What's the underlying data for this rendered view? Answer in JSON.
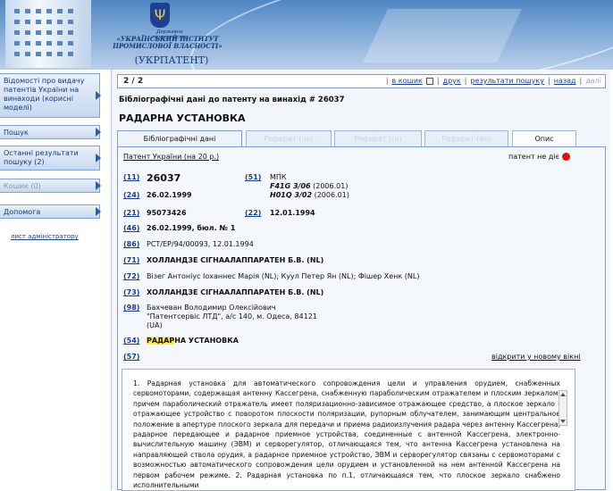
{
  "header": {
    "org_small": "Державне підприємство",
    "org_name_line1": "«УКРАЇНСЬКИЙ ІНСТИТУТ",
    "org_name_line2": "ПРОМИСЛОВОЇ ВЛАСНОСТІ»",
    "org_short": "(УКРПАТЕНТ)"
  },
  "sidebar": {
    "items": [
      {
        "label": "Відомості про видачу патентів України на винаходи (корисні моделі)",
        "disabled": false
      },
      {
        "label": "Пошук",
        "disabled": false
      },
      {
        "label": "Останні результати пошуку (2)",
        "disabled": false
      },
      {
        "label": "Кошик (0)",
        "disabled": true
      },
      {
        "label": "Допомога",
        "disabled": false
      }
    ],
    "admin_link": "лист адміністратору"
  },
  "toolbar": {
    "pager": "2 / 2",
    "to_cart": "в кошик",
    "print": "друк",
    "search_results": "результати пошуку",
    "back": "назад",
    "next": "далі"
  },
  "bib_title": "Бібліографічні дані до патенту на винахід # 26037",
  "doc_title": "РАДАРНА УСТАНОВКА",
  "tabs": [
    "Бібліографічні дані",
    "Реферат (ua)",
    "Реферат (ru)",
    "Реферат (en)",
    "Опис"
  ],
  "patent": {
    "patent_link": "Патент України (на 20 р.)",
    "status": "патент не діє",
    "c11": "(11)",
    "v11": "26037",
    "c51": "(51)",
    "mpk": "МПК",
    "ipc1": "F41G 3/06",
    "ipc1_date": "(2006.01)",
    "ipc2": "H01Q 3/02",
    "ipc2_date": "(2006.01)",
    "c24": "(24)",
    "v24": "26.02.1999",
    "c21": "(21)",
    "v21": "95073426",
    "c22": "(22)",
    "v22": "12.01.1994",
    "c46": "(46)",
    "v46": "26.02.1999, бюл. № 1",
    "c86": "(86)",
    "v86": "PCT/EP/94/00093, 12.01.1994",
    "c71": "(71)",
    "v71": "ХОЛЛАНДЗЕ СІГНААЛАППАРАТЕН Б.В. (NL)",
    "c72": "(72)",
    "v72": "Візег Антоніус Іоханнес Марія (NL); Куул Петер Ян (NL); Фішер Хенк (NL)",
    "c73": "(73)",
    "v73": "ХОЛЛАНДЗЕ СІГНААЛАППАРАТЕН Б.В. (NL)",
    "c98": "(98)",
    "v98_1": "Бахчеван Володимир Олексійович",
    "v98_2": "\"Патентсервіс ЛТД\", а/с 140, м. Одеса, 84121",
    "v98_3": "(UA)",
    "c54": "(54)",
    "v54_hl": "РАДАР",
    "v54_rest": "НА УСТАНОВКА",
    "c57": "(57)",
    "open_new": "відкрити у новому вікні"
  },
  "claims_text": "1. Радарная установка для автоматического сопровождения цели и управления орудием, снабженных сервомоторами, содержащая антенну Кассегрена, снабженную параболическим отражателем и плоским зеркалом, причем параболический отражатель имеет поляризационно-зависимое отражающее средство, а плоское зеркало - отражающее устройство с поворотом плоскости поляризации, рупорным облучателем, занимающим центральное положение в апертуре плоского зеркала для передачи и приема радиоизлучения радара через антенну Кассегрена, радарное передающее и радарное приемное устройства, соединенные с антенной Кассегрена, электронно-вычислительную машину (ЭВМ) и сервoрегулятор, отличающаяся тем, что антенна Кассегрена установлена на направляющей ствола орудия, а радарное приемное устройство, ЭВМ и сервoрегулятор связаны с сервомоторами с возможностью автоматического сопровождения цели орудием и установленной на нем антенной Кассегрена на первом рабочем режиме. 2. Радарная установка по п.1, отличающаяся тем, что плоское зеркало снабжено исполнительными"
}
